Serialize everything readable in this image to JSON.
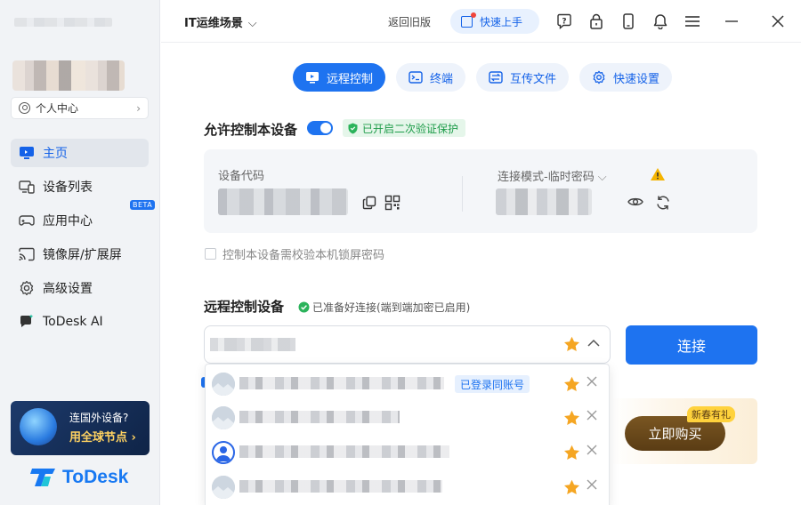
{
  "sidebar": {
    "profile_label": "个人中心",
    "nav": [
      {
        "label": "主页",
        "icon": "monitor-icon",
        "active": true
      },
      {
        "label": "设备列表",
        "icon": "devices-icon"
      },
      {
        "label": "应用中心",
        "icon": "gamepad-icon",
        "badge": "BETA"
      },
      {
        "label": "镜像屏/扩展屏",
        "icon": "cast-icon"
      },
      {
        "label": "高级设置",
        "icon": "gear-icon"
      },
      {
        "label": "ToDesk AI",
        "icon": "ai-chat-icon"
      }
    ],
    "promo": {
      "line1": "连国外设备?",
      "line2": "用全球节点 ›"
    },
    "brand": "ToDesk"
  },
  "topbar": {
    "scene": "IT运维场景",
    "old_version": "返回旧版",
    "quick_start": "快速上手",
    "icons": [
      "help-icon",
      "lock-icon",
      "phone-icon",
      "bell-icon",
      "menu-icon",
      "minimize-icon",
      "close-icon"
    ]
  },
  "tabs": [
    {
      "label": "远程控制",
      "icon": "remote-icon",
      "active": true
    },
    {
      "label": "终端",
      "icon": "terminal-icon"
    },
    {
      "label": "互传文件",
      "icon": "transfer-icon"
    },
    {
      "label": "快速设置",
      "icon": "settings-icon"
    }
  ],
  "allow": {
    "title": "允许控制本设备",
    "toggle_on": true,
    "verify_badge": "已开启二次验证保护",
    "code_label": "设备代码",
    "mode_label": "连接模式-临时密码",
    "lock_checkbox": "控制本设备需校验本机锁屏密码"
  },
  "remote": {
    "title": "远程控制设备",
    "ready_note": "已准备好连接(端到端加密已启用)",
    "connect": "连接"
  },
  "dropdown": {
    "rows": [
      {
        "avatar": "device-thumb",
        "tag": "已登录同账号",
        "name_width": 230
      },
      {
        "avatar": "device-thumb",
        "tag": "",
        "name_width": 180
      },
      {
        "avatar": "person",
        "tag": "",
        "name_width": 236
      },
      {
        "avatar": "device-thumb",
        "tag": "",
        "name_width": 228
      }
    ]
  },
  "promo_right": {
    "buy": "立即购买",
    "tag": "新春有礼"
  },
  "colors": {
    "accent": "#1e73f0",
    "star": "#f5a623",
    "green": "#1e9c4a"
  }
}
